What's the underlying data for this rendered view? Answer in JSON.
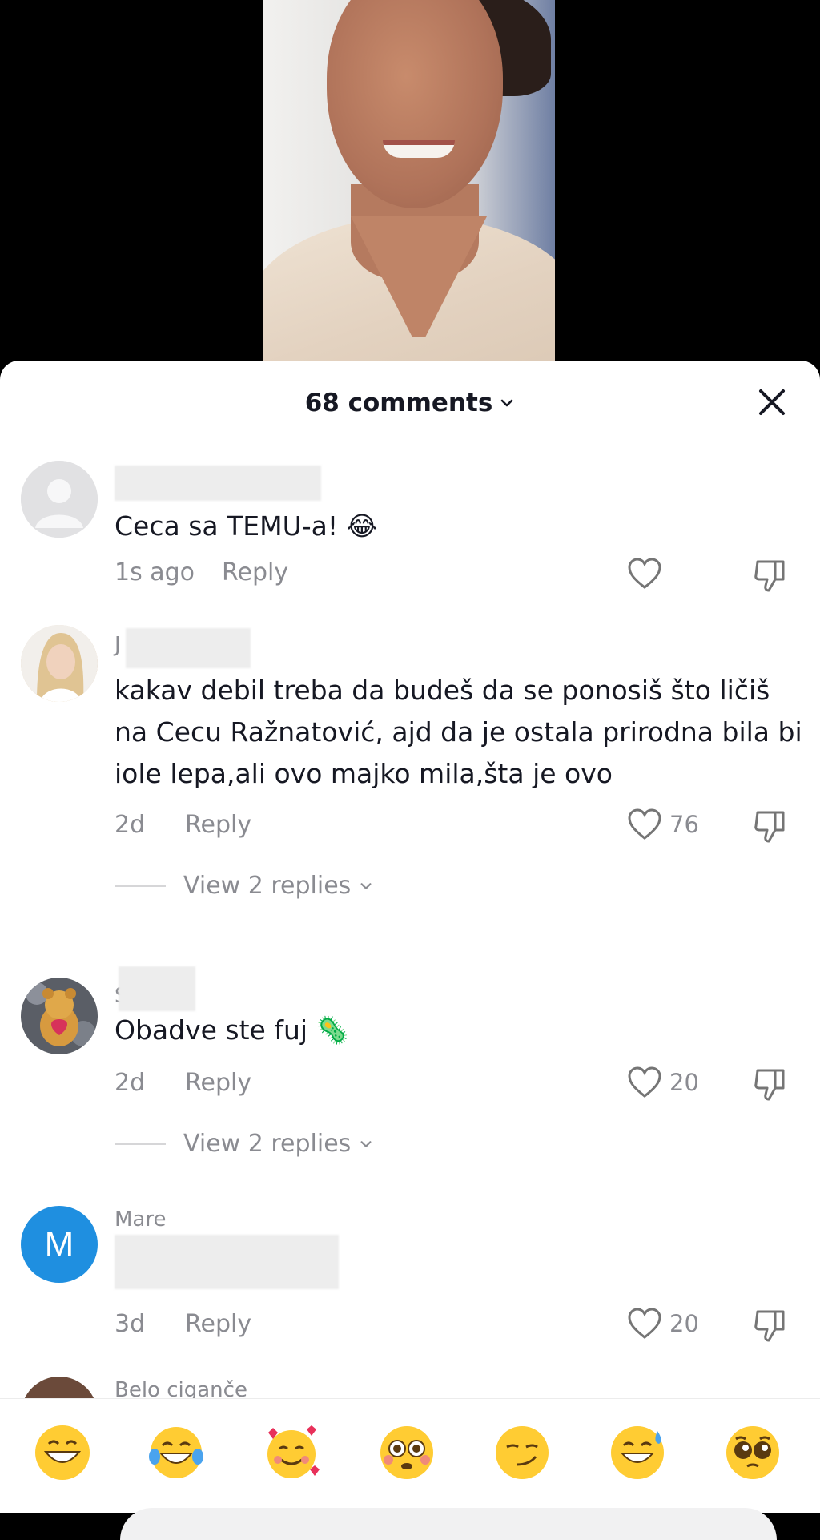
{
  "header": {
    "comment_count": "68 comments"
  },
  "comments": [
    {
      "username": "",
      "text": "Ceca sa TEMU-a! 😂",
      "time": "1s ago",
      "reply": "Reply",
      "likes": ""
    },
    {
      "username": "J",
      "text": "kakav debil treba da budeš da se ponosiš što ličiš na Cecu Ražnatović, ajd da je ostala prirodna bila bi iole lepa,ali ovo majko mila,šta je ovo",
      "time": "2d",
      "reply": "Reply",
      "likes": "76",
      "view_replies": "View 2 replies"
    },
    {
      "username": "S",
      "text": "Obadve ste fuj 🦠",
      "time": "2d",
      "reply": "Reply",
      "likes": "20",
      "view_replies": "View 2 replies"
    },
    {
      "username": "Mare",
      "avatar_letter": "M",
      "text": "",
      "time": "3d",
      "reply": "Reply",
      "likes": "20"
    },
    {
      "username": "Belo ciganče"
    }
  ],
  "emoji_bar": [
    {
      "name": "grinning-emoji"
    },
    {
      "name": "tears-of-joy-emoji"
    },
    {
      "name": "smiling-hearts-emoji"
    },
    {
      "name": "flushed-emoji"
    },
    {
      "name": "smirk-emoji"
    },
    {
      "name": "sweat-smile-emoji"
    },
    {
      "name": "pleading-emoji"
    }
  ],
  "colors": {
    "text": "#161823",
    "muted": "#8a8b91",
    "avatar_blue": "#1f8fe0"
  },
  "icons": [
    "chevron-down-icon",
    "close-icon",
    "heart-icon",
    "dislike-icon"
  ]
}
